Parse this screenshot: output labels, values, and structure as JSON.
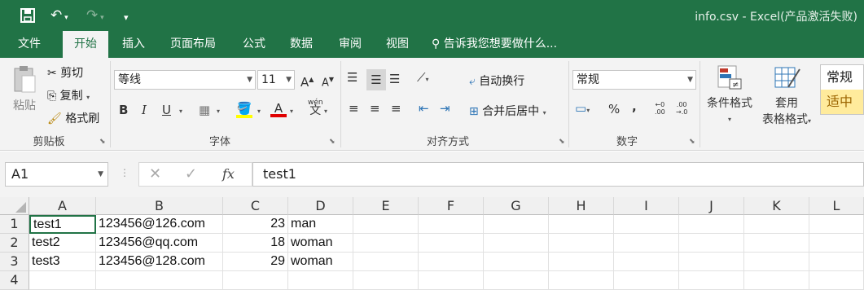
{
  "window": {
    "title": "info.csv - Excel(产品激活失败)"
  },
  "tabs": [
    "文件",
    "开始",
    "插入",
    "页面布局",
    "公式",
    "数据",
    "审阅",
    "视图"
  ],
  "tell_me": "告诉我您想要做什么...",
  "clipboard": {
    "paste": "粘贴",
    "cut": "剪切",
    "copy": "复制",
    "format_painter": "格式刷",
    "group": "剪贴板"
  },
  "font": {
    "name": "等线",
    "size": "11",
    "bold": "B",
    "italic": "I",
    "underline": "U",
    "grow": "A",
    "shrink": "A",
    "color_a": "A",
    "wen": "wén",
    "group": "字体"
  },
  "alignment": {
    "wrap": "自动换行",
    "merge": "合并后居中",
    "group": "对齐方式"
  },
  "number": {
    "format": "常规",
    "percent": "%",
    "comma": ",",
    "group": "数字"
  },
  "styles": {
    "conditional": "条件格式",
    "table1": "套用",
    "table2": "表格格式",
    "normal": "常规",
    "neutral": "适中"
  },
  "formula_bar": {
    "name_box": "A1",
    "value": "test1",
    "fx": "fx"
  },
  "columns": [
    "A",
    "B",
    "C",
    "D",
    "E",
    "F",
    "G",
    "H",
    "I",
    "J",
    "K",
    "L"
  ],
  "rows": [
    {
      "num": "1",
      "a": "test1",
      "b": "123456@126.com",
      "c": "23",
      "d": "man"
    },
    {
      "num": "2",
      "a": "test2",
      "b": "123456@qq.com",
      "c": "18",
      "d": "woman"
    },
    {
      "num": "3",
      "a": "test3",
      "b": "123456@128.com",
      "c": "29",
      "d": "woman"
    },
    {
      "num": "4",
      "a": "",
      "b": "",
      "c": "",
      "d": ""
    }
  ],
  "colors": {
    "brand": "#217346",
    "neutral_fill": "#ffeb9c",
    "neutral_text": "#9c6500"
  }
}
